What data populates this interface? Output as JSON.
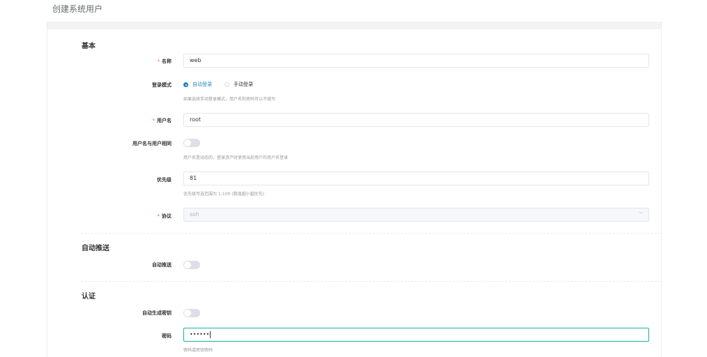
{
  "page": {
    "title": "创建系统用户"
  },
  "sections": {
    "basic": "基本",
    "auto_push": "自动推送",
    "auth": "认证"
  },
  "fields": {
    "name": {
      "required_mark": "*",
      "label": "名称",
      "value": "web"
    },
    "login_mode": {
      "label": "登录模式",
      "options": [
        "自动登录",
        "手动登录"
      ],
      "selected": "自动登录",
      "help": "如果选择手动登录模式，用户名和密码可以不填写"
    },
    "username": {
      "required_mark": "*",
      "label": "用户名",
      "value": "root"
    },
    "username_same_as_user": {
      "label": "用户名与用户相同",
      "enabled": false,
      "help": "用户名是动态的，登录资产时使用当前用户的用户名登录"
    },
    "priority": {
      "label": "优先级",
      "value": "81",
      "help": "优先级可选范围为 1-100 (数值越小越优先)"
    },
    "protocol": {
      "required_mark": "*",
      "label": "协议",
      "value": "ssh"
    },
    "auto_push": {
      "label": "自动推送",
      "enabled": false
    },
    "auto_generate_key": {
      "label": "自动生成密钥",
      "enabled": false
    },
    "password": {
      "label": "密码",
      "value": "••••••",
      "help": "密码或密钥密码"
    }
  },
  "colors": {
    "accent": "#1c84c6",
    "focus_border": "#1ab394",
    "required": "#ed5565"
  }
}
